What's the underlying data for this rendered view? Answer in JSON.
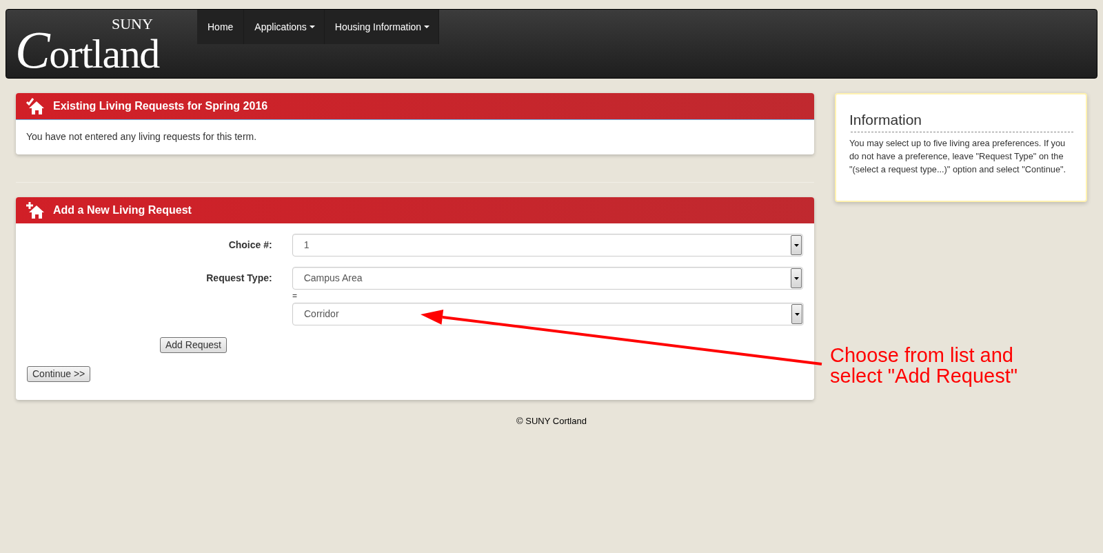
{
  "navbar": {
    "logo": {
      "subtitle": "SUNY",
      "wordmark": "Cortland"
    },
    "items": [
      {
        "label": "Home",
        "dropdown": false
      },
      {
        "label": "Applications",
        "dropdown": true
      },
      {
        "label": "Housing Information",
        "dropdown": true
      }
    ]
  },
  "existing_requests": {
    "title": "Existing Living Requests for Spring 2016",
    "message": "You have not entered any living requests for this term."
  },
  "new_request": {
    "title": "Add a New Living Request",
    "fields": [
      {
        "label": "Choice #:",
        "value": "1"
      },
      {
        "label": "Request Type:",
        "value": "Campus Area"
      }
    ],
    "sub_select": {
      "prefix": "=",
      "value": "Corridor"
    },
    "add_button": "Add Request",
    "continue_button": "Continue >>"
  },
  "information": {
    "title": "Information",
    "text": "You may select up to five living area preferences. If you do not have a preference, leave \"Request Type\" on the \"(select a request type...)\" option and select \"Continue\"."
  },
  "footer": "© SUNY Cortland",
  "annotation": {
    "text": "Choose from list and select \"Add Request\""
  }
}
